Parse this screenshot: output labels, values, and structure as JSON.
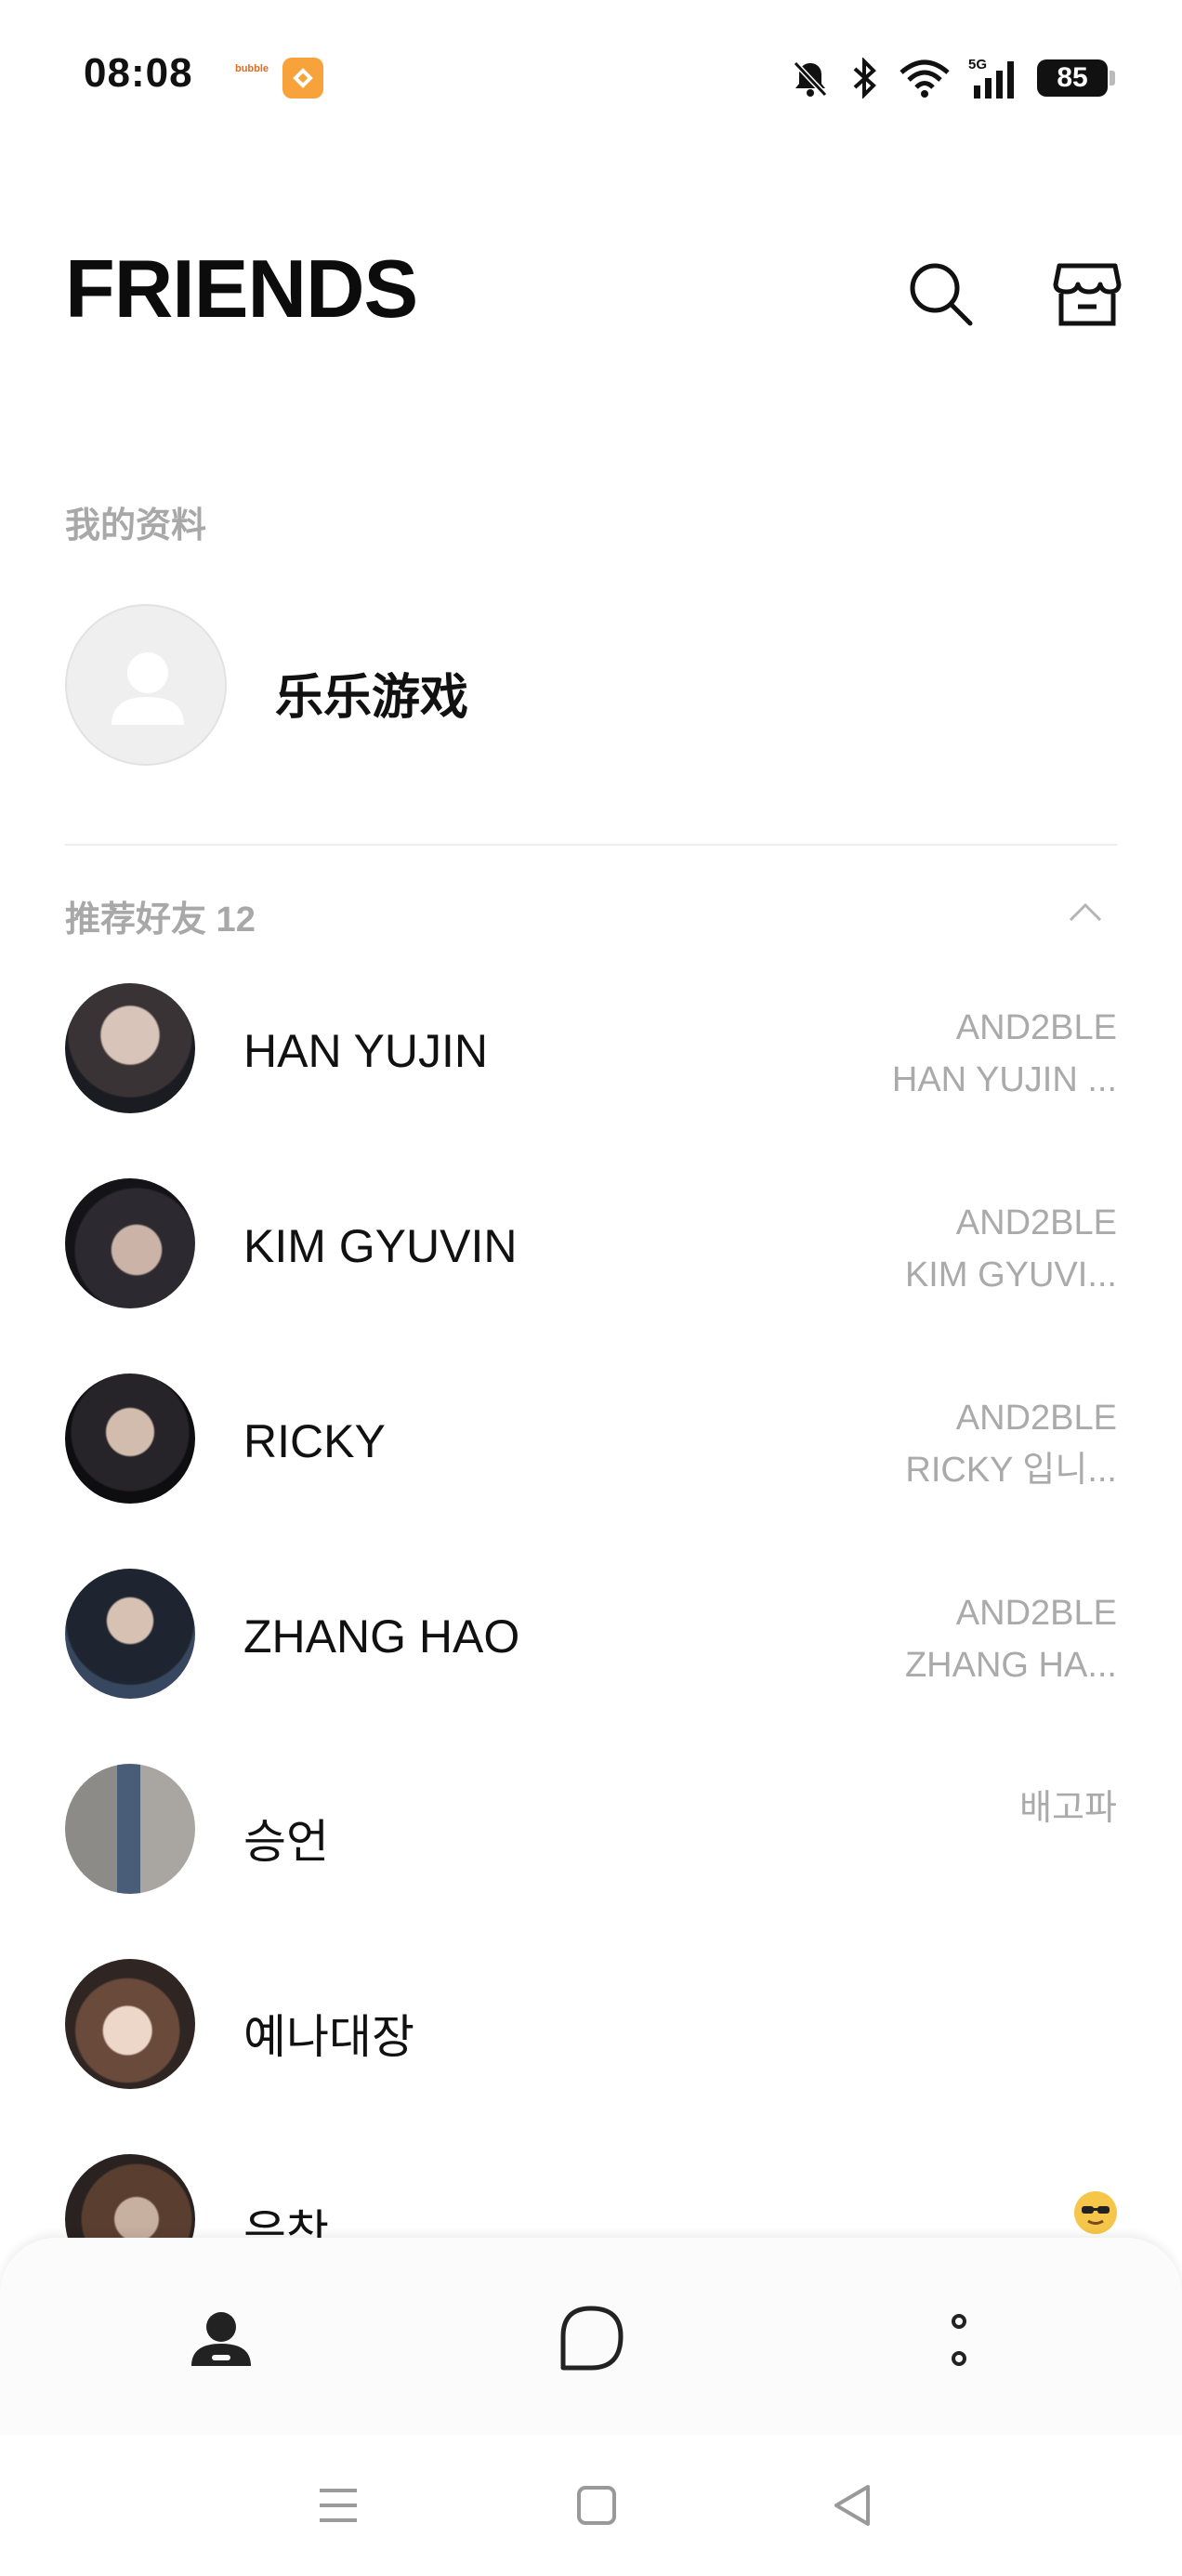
{
  "status_bar": {
    "time": "08:08",
    "app1_label": "bubble",
    "battery": "85",
    "network": "5G",
    "icons": [
      "bell-muted-icon",
      "bluetooth-icon",
      "wifi-icon",
      "signal-icon",
      "battery-icon"
    ]
  },
  "header": {
    "title": "FRIENDS",
    "icons": [
      "search-icon",
      "shop-icon"
    ]
  },
  "my_profile": {
    "section_label": "我的资料",
    "name": "乐乐游戏"
  },
  "recommended": {
    "section_label": "推荐好友 12",
    "friends": [
      {
        "name": "HAN YUJIN",
        "status_line1": "AND2BLE",
        "status_line2": "HAN YUJIN ..."
      },
      {
        "name": "KIM GYUVIN",
        "status_line1": "AND2BLE",
        "status_line2": "KIM GYUVI..."
      },
      {
        "name": "RICKY",
        "status_line1": "AND2BLE",
        "status_line2": "RICKY 입니..."
      },
      {
        "name": "ZHANG HAO",
        "status_line1": "AND2BLE",
        "status_line2": "ZHANG HA..."
      },
      {
        "name": "승언",
        "status_line1": "배고파",
        "status_line2": ""
      },
      {
        "name": "예나대장",
        "status_line1": "",
        "status_line2": ""
      },
      {
        "name": "은찬",
        "status_line1": "",
        "status_line2": "",
        "emoji": "😎"
      }
    ]
  },
  "tab_bar": {
    "tabs": [
      "friends-tab",
      "chats-tab",
      "more-tab"
    ]
  },
  "colors": {
    "accent": "#111111",
    "muted_text": "#aaaaaa",
    "divider": "#ececec"
  }
}
